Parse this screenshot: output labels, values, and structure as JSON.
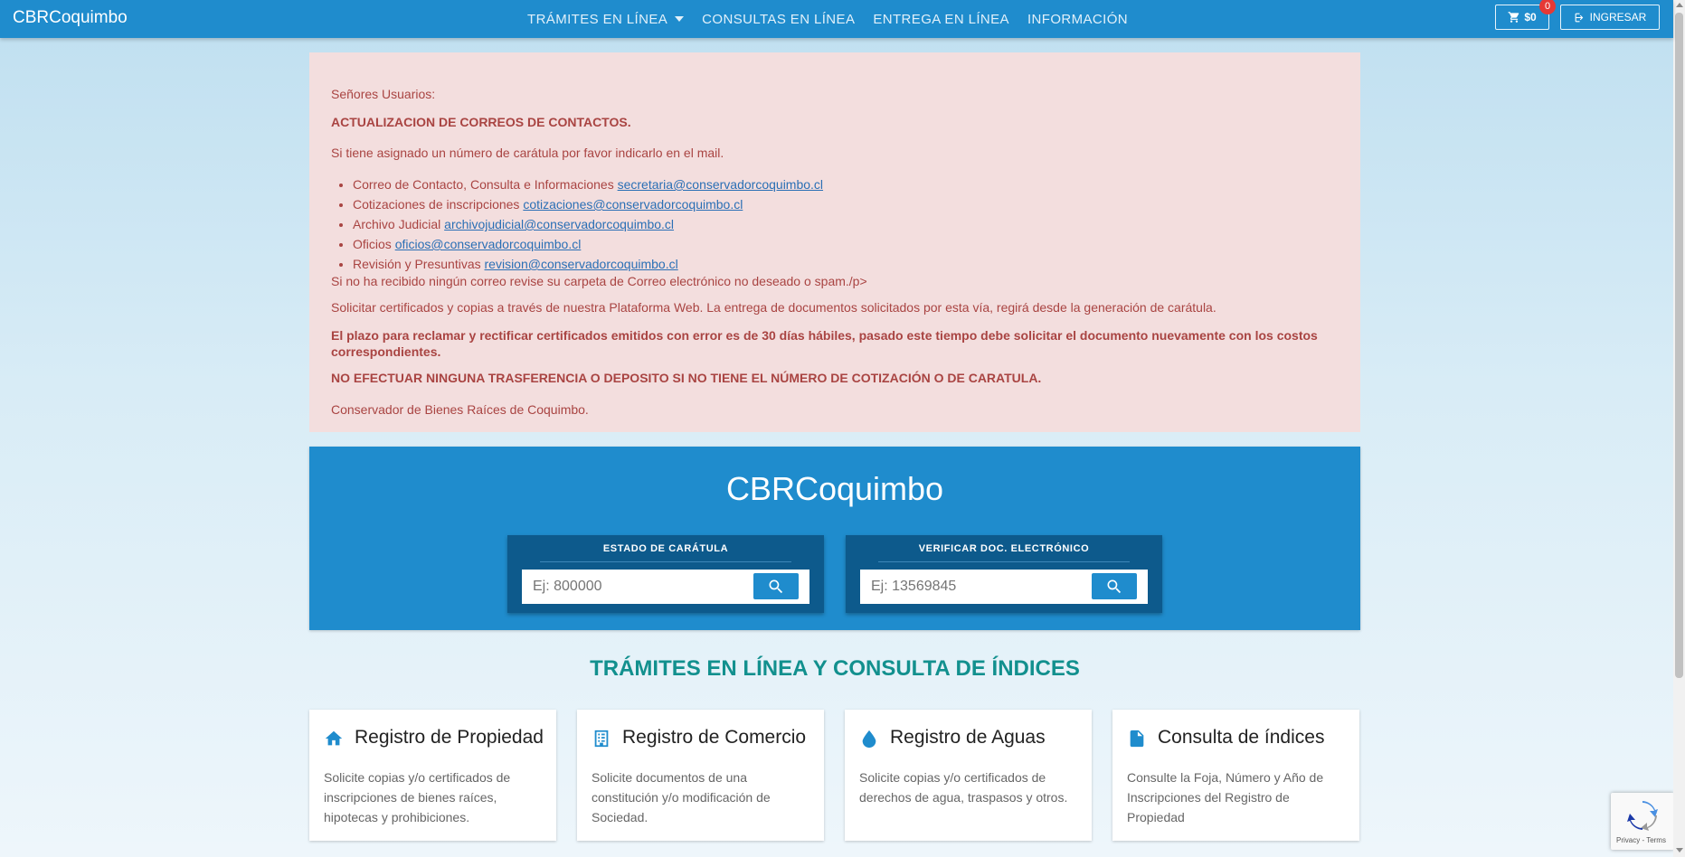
{
  "navbar": {
    "brand": "CBRCoquimbo",
    "links": [
      "TRÁMITES EN LÍNEA",
      "CONSULTAS EN LÍNEA",
      "ENTREGA EN LÍNEA",
      "INFORMACIÓN"
    ],
    "cart_amount": "$0",
    "cart_badge": "0",
    "login": "INGRESAR"
  },
  "alert": {
    "greeting": "Señores Usuarios:",
    "heading": "ACTUALIZACION DE CORREOS DE CONTACTOS.",
    "intro": "Si tiene asignado un número de carátula por favor indicarlo en el mail.",
    "contacts": [
      {
        "label": "Correo de Contacto, Consulta e Informaciones ",
        "email": "secretaria@conservadorcoquimbo.cl"
      },
      {
        "label": "Cotizaciones de inscripciones ",
        "email": "cotizaciones@conservadorcoquimbo.cl"
      },
      {
        "label": "Archivo Judicial ",
        "email": "archivojudicial@conservadorcoquimbo.cl"
      },
      {
        "label": "Oficios ",
        "email": "oficios@conservadorcoquimbo.cl"
      },
      {
        "label": "Revisión y Presuntivas ",
        "email": "revision@conservadorcoquimbo.cl"
      }
    ],
    "spam_note": "Si no ha recibido ningún correo revise su carpeta de Correo electrónico no deseado o spam./p>",
    "platform_note": "Solicitar certificados y copias a través de nuestra Plataforma Web. La entrega de documentos solicitados por esta vía, regirá desde la generación de carátula.",
    "deadline_note": "El plazo para reclamar y rectificar certificados emitidos con error es de 30 días hábiles, pasado este tiempo debe solicitar el documento nuevamente con los costos correspondientes.",
    "warning": "NO EFECTUAR NINGUNA TRASFERENCIA O DEPOSITO SI NO TIENE EL NÚMERO DE COTIZACIÓN O DE CARATULA.",
    "signature": "Conservador de Bienes Raíces de Coquimbo."
  },
  "hero": {
    "title": "CBRCoquimbo",
    "search_caratula": {
      "label": "ESTADO DE CARÁTULA",
      "placeholder": "Ej: 800000"
    },
    "search_doc": {
      "label": "VERIFICAR DOC. ELECTRÓNICO",
      "placeholder": "Ej: 13569845"
    }
  },
  "section_title": "TRÁMITES EN LÍNEA Y CONSULTA DE ÍNDICES",
  "cards": [
    {
      "icon": "home-icon",
      "title": "Registro de Propiedad",
      "desc": "Solicite copias y/o certificados de inscripciones de bienes raíces, hipotecas y prohibiciones."
    },
    {
      "icon": "building-icon",
      "title": "Registro de Comercio",
      "desc": "Solicite documentos de una constitución y/o modificación de Sociedad."
    },
    {
      "icon": "water-drop-icon",
      "title": "Registro de Aguas",
      "desc": "Solicite copias y/o certificados de derechos de agua, traspasos y otros."
    },
    {
      "icon": "document-icon",
      "title": "Consulta de índices",
      "desc": "Consulte la Foja, Número y Año de Inscripciones del Registro de Propiedad"
    }
  ],
  "recaptcha": {
    "text": "Privacy - Terms"
  },
  "colors": {
    "primary": "#1f8ccd",
    "dark_primary": "#0d5a8c",
    "alert_bg": "#f3dede",
    "alert_text": "#a94442",
    "teal_title": "#12908e",
    "badge": "#e53935"
  }
}
